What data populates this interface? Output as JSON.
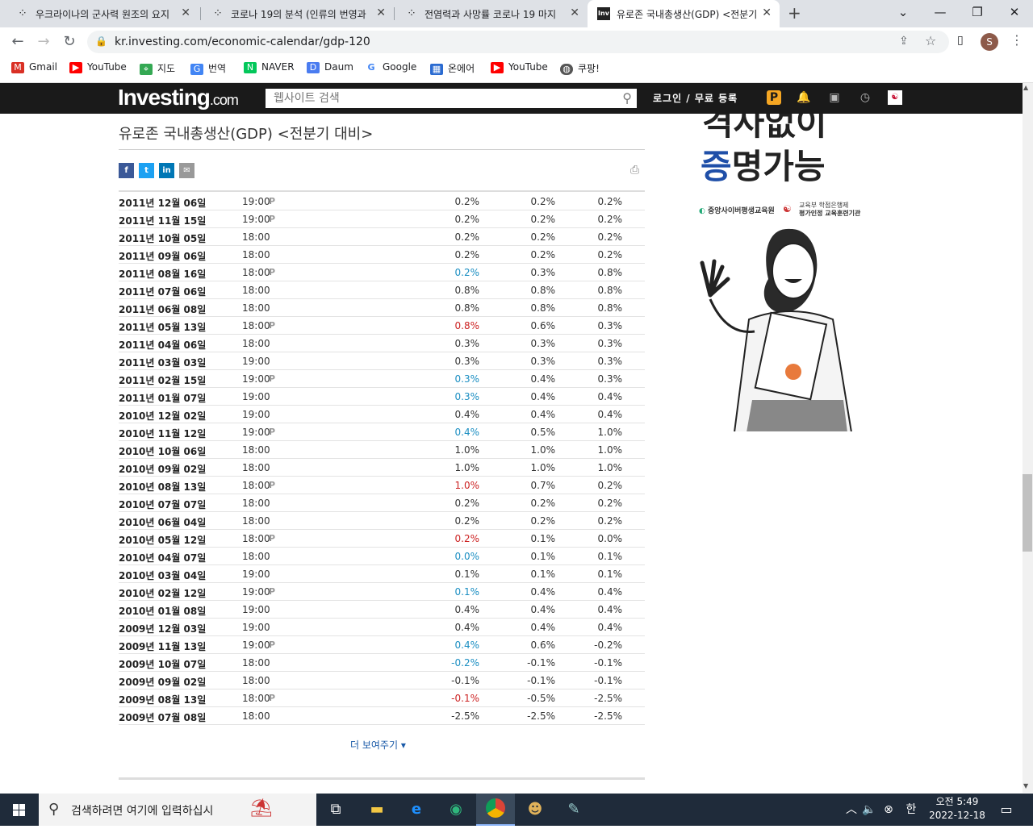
{
  "browser": {
    "tabs": [
      {
        "title": "우크라이나의 군사력 원조의 요지",
        "favicon": "dots-icon"
      },
      {
        "title": "코로나 19의 분석 (인류의 번영과",
        "favicon": "dots-icon"
      },
      {
        "title": "전염력과 사망률 코로나 19 마지",
        "favicon": "dots-icon"
      },
      {
        "title": "유로존 국내총생산(GDP) <전분기",
        "favicon": "investing-icon",
        "active": true
      }
    ],
    "new_tab": "+",
    "url": "kr.investing.com/economic-calendar/gdp-120",
    "profile_initial": "S",
    "bookmarks": [
      {
        "label": "Gmail",
        "icon": "gmail-icon",
        "color": "#d93025"
      },
      {
        "label": "YouTube",
        "icon": "youtube-icon",
        "color": "#ff0000"
      },
      {
        "label": "지도",
        "icon": "maps-icon",
        "color": "#34a853"
      },
      {
        "label": "번역",
        "icon": "translate-icon",
        "color": "#4285f4"
      },
      {
        "label": "NAVER",
        "icon": "naver-icon",
        "color": "#03c75a"
      },
      {
        "label": "Daum",
        "icon": "daum-icon",
        "color": "#4a7cf0"
      },
      {
        "label": "Google",
        "icon": "google-icon",
        "color": "#4285f4"
      },
      {
        "label": "온에어",
        "icon": "onair-icon",
        "color": "#2a6bd1"
      },
      {
        "label": "YouTube",
        "icon": "youtube-icon",
        "color": "#ff0000"
      },
      {
        "label": "쿠팡!",
        "icon": "globe-icon",
        "color": "#555555"
      }
    ]
  },
  "site": {
    "logo_main": "Investing",
    "logo_suffix": ".com",
    "search_placeholder": "웹사이트 검색",
    "login_label": "로그인 / 무료 등록"
  },
  "page": {
    "title": "유로존 국내총생산(GDP) <전분기 대비>",
    "show_more": "더 보여주기 ▾",
    "colors": {
      "positive": "#1a8ec2",
      "negative": "#cc2222"
    }
  },
  "rows": [
    {
      "date": "2011년 12월 06일",
      "time": "19:00",
      "p": "P",
      "actual": "0.2%",
      "forecast": "0.2%",
      "previous": "0.2%",
      "tone": "neu"
    },
    {
      "date": "2011년 11월 15일",
      "time": "19:00",
      "p": "P",
      "actual": "0.2%",
      "forecast": "0.2%",
      "previous": "0.2%",
      "tone": "neu"
    },
    {
      "date": "2011년 10월 05일",
      "time": "18:00",
      "p": "",
      "actual": "0.2%",
      "forecast": "0.2%",
      "previous": "0.2%",
      "tone": "neu"
    },
    {
      "date": "2011년 09월 06일",
      "time": "18:00",
      "p": "",
      "actual": "0.2%",
      "forecast": "0.2%",
      "previous": "0.2%",
      "tone": "neu"
    },
    {
      "date": "2011년 08월 16일",
      "time": "18:00",
      "p": "P",
      "actual": "0.2%",
      "forecast": "0.3%",
      "previous": "0.8%",
      "tone": "pos"
    },
    {
      "date": "2011년 07월 06일",
      "time": "18:00",
      "p": "",
      "actual": "0.8%",
      "forecast": "0.8%",
      "previous": "0.8%",
      "tone": "neu"
    },
    {
      "date": "2011년 06월 08일",
      "time": "18:00",
      "p": "",
      "actual": "0.8%",
      "forecast": "0.8%",
      "previous": "0.8%",
      "tone": "neu"
    },
    {
      "date": "2011년 05월 13일",
      "time": "18:00",
      "p": "P",
      "actual": "0.8%",
      "forecast": "0.6%",
      "previous": "0.3%",
      "tone": "neg"
    },
    {
      "date": "2011년 04월 06일",
      "time": "18:00",
      "p": "",
      "actual": "0.3%",
      "forecast": "0.3%",
      "previous": "0.3%",
      "tone": "neu"
    },
    {
      "date": "2011년 03월 03일",
      "time": "19:00",
      "p": "",
      "actual": "0.3%",
      "forecast": "0.3%",
      "previous": "0.3%",
      "tone": "neu"
    },
    {
      "date": "2011년 02월 15일",
      "time": "19:00",
      "p": "P",
      "actual": "0.3%",
      "forecast": "0.4%",
      "previous": "0.3%",
      "tone": "pos"
    },
    {
      "date": "2011년 01월 07일",
      "time": "19:00",
      "p": "",
      "actual": "0.3%",
      "forecast": "0.4%",
      "previous": "0.4%",
      "tone": "pos"
    },
    {
      "date": "2010년 12월 02일",
      "time": "19:00",
      "p": "",
      "actual": "0.4%",
      "forecast": "0.4%",
      "previous": "0.4%",
      "tone": "neu"
    },
    {
      "date": "2010년 11월 12일",
      "time": "19:00",
      "p": "P",
      "actual": "0.4%",
      "forecast": "0.5%",
      "previous": "1.0%",
      "tone": "pos"
    },
    {
      "date": "2010년 10월 06일",
      "time": "18:00",
      "p": "",
      "actual": "1.0%",
      "forecast": "1.0%",
      "previous": "1.0%",
      "tone": "neu"
    },
    {
      "date": "2010년 09월 02일",
      "time": "18:00",
      "p": "",
      "actual": "1.0%",
      "forecast": "1.0%",
      "previous": "1.0%",
      "tone": "neu"
    },
    {
      "date": "2010년 08월 13일",
      "time": "18:00",
      "p": "P",
      "actual": "1.0%",
      "forecast": "0.7%",
      "previous": "0.2%",
      "tone": "neg"
    },
    {
      "date": "2010년 07월 07일",
      "time": "18:00",
      "p": "",
      "actual": "0.2%",
      "forecast": "0.2%",
      "previous": "0.2%",
      "tone": "neu"
    },
    {
      "date": "2010년 06월 04일",
      "time": "18:00",
      "p": "",
      "actual": "0.2%",
      "forecast": "0.2%",
      "previous": "0.2%",
      "tone": "neu"
    },
    {
      "date": "2010년 05월 12일",
      "time": "18:00",
      "p": "P",
      "actual": "0.2%",
      "forecast": "0.1%",
      "previous": "0.0%",
      "tone": "neg"
    },
    {
      "date": "2010년 04월 07일",
      "time": "18:00",
      "p": "",
      "actual": "0.0%",
      "forecast": "0.1%",
      "previous": "0.1%",
      "tone": "pos"
    },
    {
      "date": "2010년 03월 04일",
      "time": "19:00",
      "p": "",
      "actual": "0.1%",
      "forecast": "0.1%",
      "previous": "0.1%",
      "tone": "neu"
    },
    {
      "date": "2010년 02월 12일",
      "time": "19:00",
      "p": "P",
      "actual": "0.1%",
      "forecast": "0.4%",
      "previous": "0.4%",
      "tone": "pos"
    },
    {
      "date": "2010년 01월 08일",
      "time": "19:00",
      "p": "",
      "actual": "0.4%",
      "forecast": "0.4%",
      "previous": "0.4%",
      "tone": "neu"
    },
    {
      "date": "2009년 12월 03일",
      "time": "19:00",
      "p": "",
      "actual": "0.4%",
      "forecast": "0.4%",
      "previous": "0.4%",
      "tone": "neu"
    },
    {
      "date": "2009년 11월 13일",
      "time": "19:00",
      "p": "P",
      "actual": "0.4%",
      "forecast": "0.6%",
      "previous": "-0.2%",
      "tone": "pos"
    },
    {
      "date": "2009년 10월 07일",
      "time": "18:00",
      "p": "",
      "actual": "-0.2%",
      "forecast": "-0.1%",
      "previous": "-0.1%",
      "tone": "pos"
    },
    {
      "date": "2009년 09월 02일",
      "time": "18:00",
      "p": "",
      "actual": "-0.1%",
      "forecast": "-0.1%",
      "previous": "-0.1%",
      "tone": "neu"
    },
    {
      "date": "2009년 08월 13일",
      "time": "18:00",
      "p": "P",
      "actual": "-0.1%",
      "forecast": "-0.5%",
      "previous": "-2.5%",
      "tone": "neg"
    },
    {
      "date": "2009년 07월 08일",
      "time": "18:00",
      "p": "",
      "actual": "-2.5%",
      "forecast": "-2.5%",
      "previous": "-2.5%",
      "tone": "neu"
    }
  ],
  "ad": {
    "line1": "격사없이",
    "line2a": "증",
    "line2b": "명가능",
    "org1": "중앙사이버평생교육원",
    "org2_small": "교육부 학점은행제",
    "org2": "평가인정 교육훈련기관"
  },
  "taskbar": {
    "search_placeholder": "검색하려면 여기에 입력하십시",
    "time": "오전 5:49",
    "date": "2022-12-18",
    "ime": "한"
  }
}
